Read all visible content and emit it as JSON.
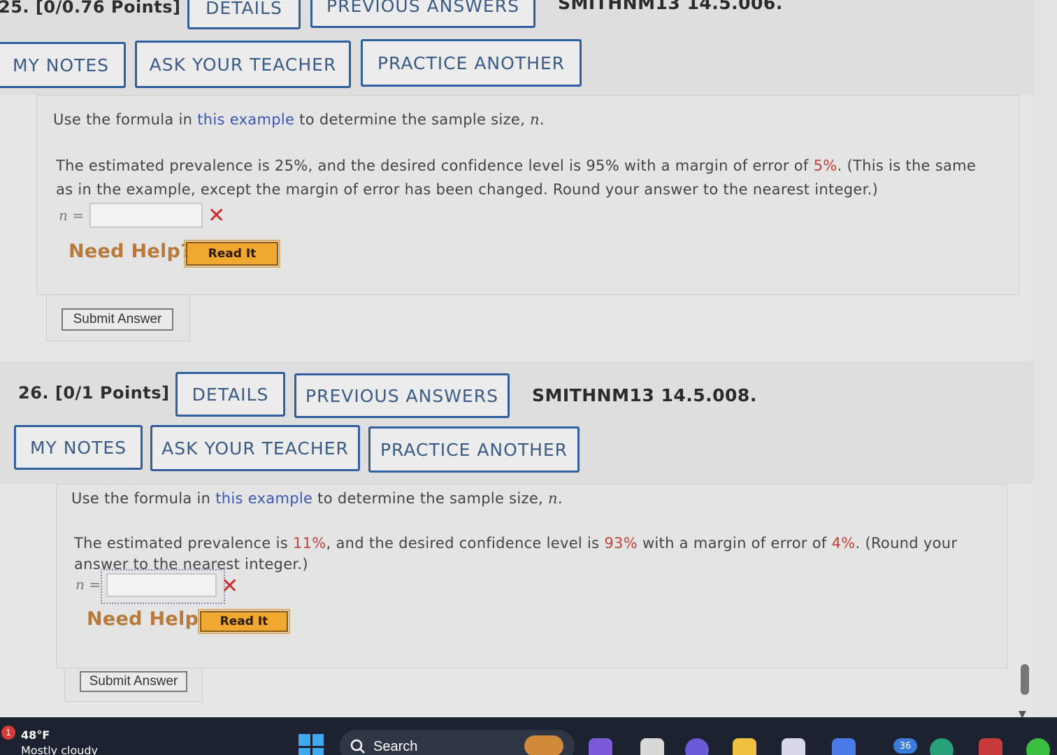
{
  "q25": {
    "number_label": "25. [0/0.76 Points]",
    "details_label": "DETAILS",
    "previous_answers_label": "PREVIOUS ANSWERS",
    "problem_id": "SMITHNM13 14.5.006.",
    "my_notes_label": "MY NOTES",
    "ask_teacher_label": "ASK YOUR TEACHER",
    "practice_label": "PRACTICE ANOTHER",
    "intro_before": "Use the formula in ",
    "intro_link": "this example",
    "intro_after": " to determine the sample size, ",
    "intro_var": "n",
    "intro_end": ".",
    "line1_a": "The estimated prevalence is 25%, and the desired confidence level is 95% with a margin of error of ",
    "line1_hl": "5%",
    "line1_b": ". (This is the same",
    "line2": "as in the example, except the margin of error has been changed. Round your answer to the nearest integer.)",
    "n_label": "n =",
    "answer_value": "",
    "need_help_label": "Need Help?",
    "read_it_label": "Read It",
    "submit_label": "Submit Answer"
  },
  "q26": {
    "number_label": "26. [0/1 Points]",
    "details_label": "DETAILS",
    "previous_answers_label": "PREVIOUS ANSWERS",
    "problem_id": "SMITHNM13 14.5.008.",
    "my_notes_label": "MY NOTES",
    "ask_teacher_label": "ASK YOUR TEACHER",
    "practice_label": "PRACTICE ANOTHER",
    "intro_before": "Use the formula in ",
    "intro_link": "this example",
    "intro_after": " to determine the sample size, ",
    "intro_var": "n",
    "intro_end": ".",
    "line1_a": "The estimated prevalence is ",
    "prevalence": "11%",
    "line1_b": ", and the desired confidence level is ",
    "confidence": "93%",
    "line1_c": " with a margin of error of ",
    "margin": "4%",
    "line1_d": ". (Round your",
    "line2": "answer to the nearest integer.)",
    "n_label": "n =",
    "answer_value": "",
    "need_help_label": "Need Help?",
    "read_it_label": "Read It",
    "submit_label": "Submit Answer"
  },
  "taskbar": {
    "weather_badge": "1",
    "temperature": "48°F",
    "condition": "Mostly cloudy",
    "search_label": "Search",
    "notification_count": "36"
  },
  "colors": {
    "button_border": "#2f5f9f",
    "link": "#3b56b8",
    "highlight": "#c0433a",
    "need_help": "#b87a3a",
    "read_it_bg": "#f0a830",
    "incorrect": "#cc2c2c"
  },
  "icons": [
    "incorrect-x-icon",
    "windows-start-icon",
    "search-icon",
    "scroll-down-arrow-icon"
  ]
}
